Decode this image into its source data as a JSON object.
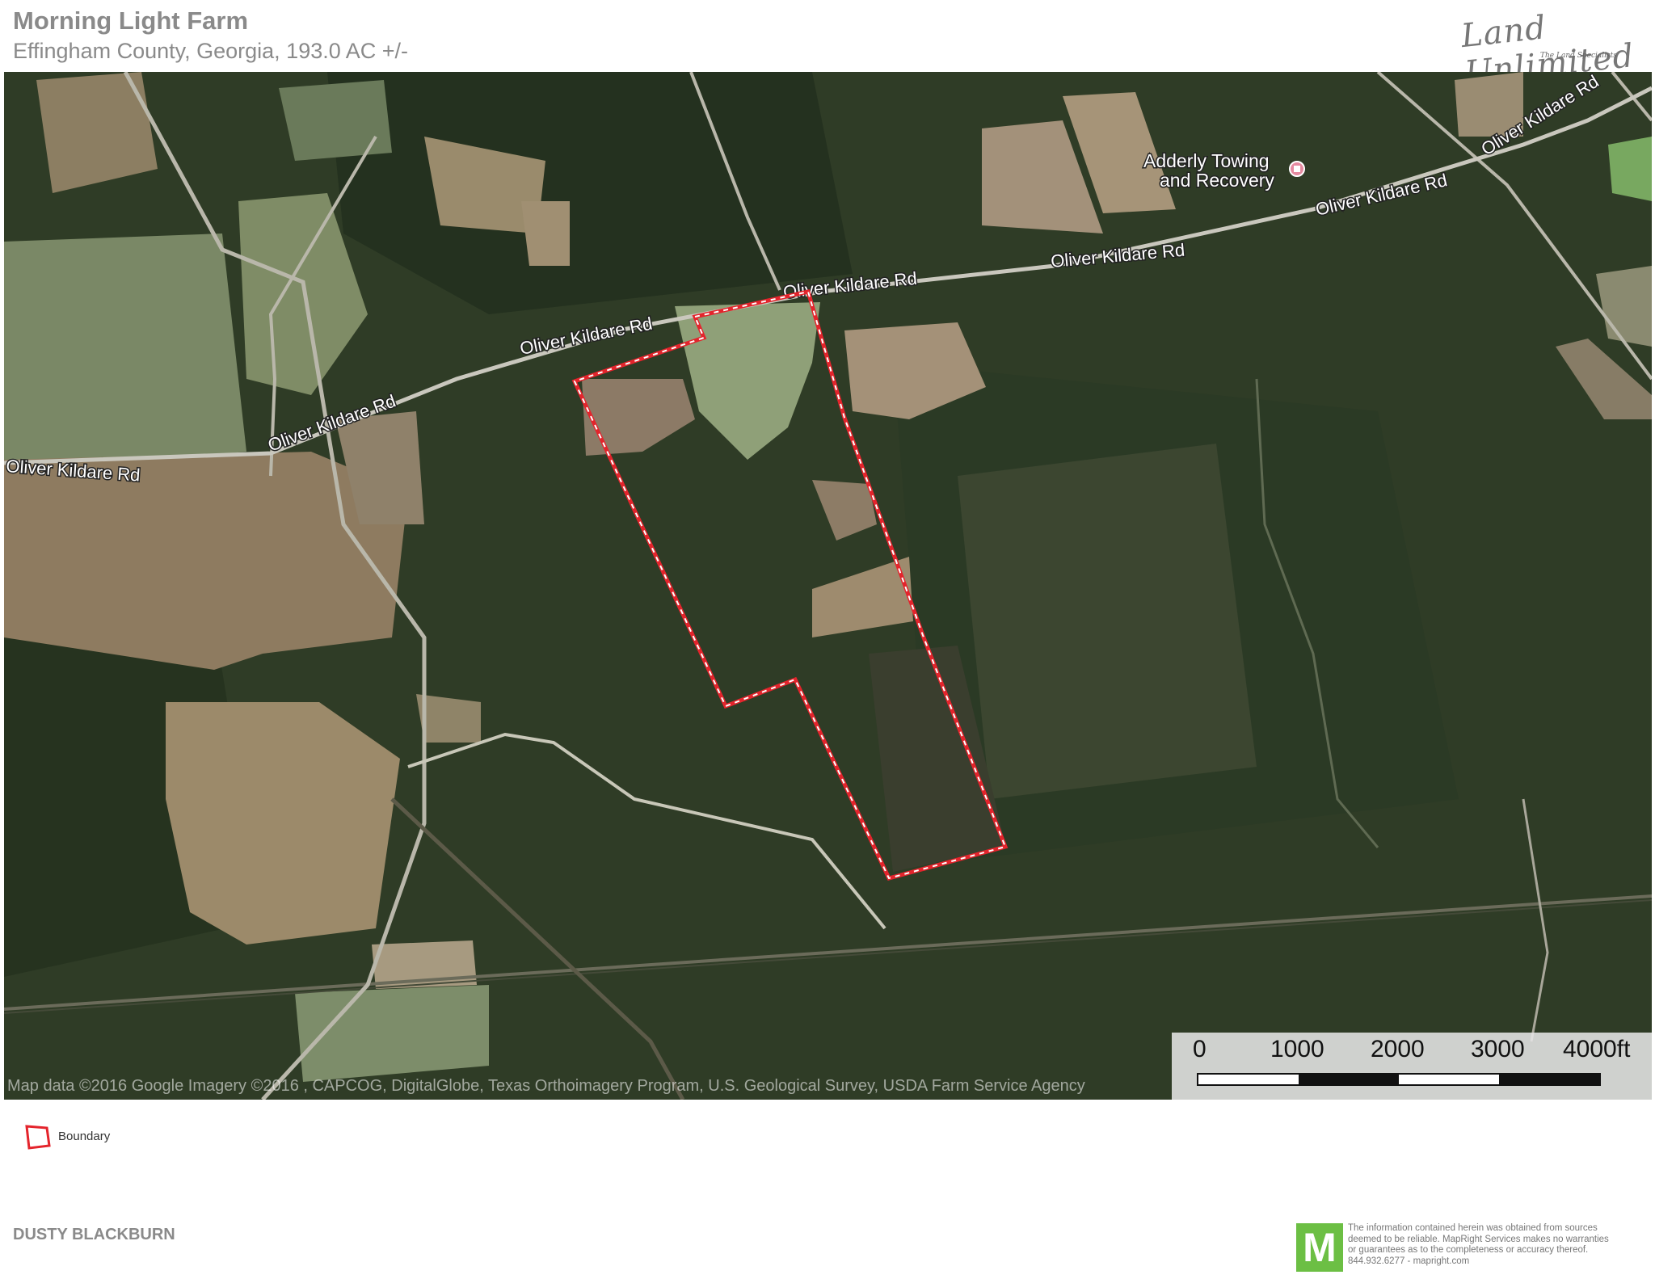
{
  "header": {
    "title": "Morning Light Farm",
    "subtitle": "Effingham County, Georgia, 193.0  AC +/-"
  },
  "logo": {
    "name": "Land Unlimited",
    "tagline": "The Land Specialists"
  },
  "map": {
    "road_labels": [
      "Oliver Kildare Rd",
      "Oliver Kildare Rd",
      "Oliver Kildare Rd",
      "Oliver Kildare Rd",
      "Oliver Kildare Rd",
      "Oliver Kildare Rd",
      "Oliver Kildare Rd"
    ],
    "poi": {
      "line1": "Adderly Towing",
      "line2": "and Recovery"
    },
    "attribution": "Map data ©2016 Google  Imagery ©2016 , CAPCOG, DigitalGlobe, Texas Orthoimagery Program, U.S. Geological Survey, USDA Farm Service Agency",
    "boundary_color": "#e4242c"
  },
  "scale": {
    "labels": [
      "0",
      "1000",
      "2000",
      "3000",
      "4000ft"
    ]
  },
  "legend": {
    "boundary_label": "Boundary"
  },
  "footer": {
    "agent": "DUSTY BLACKBURN",
    "mapright_logo": "M",
    "disclaimer_lines": [
      "The information contained herein was obtained from sources",
      "deemed to be reliable. MapRight Services makes no warranties",
      "or guarantees as to the completeness or accuracy thereof.",
      "844.932.6277 - mapright.com"
    ]
  }
}
